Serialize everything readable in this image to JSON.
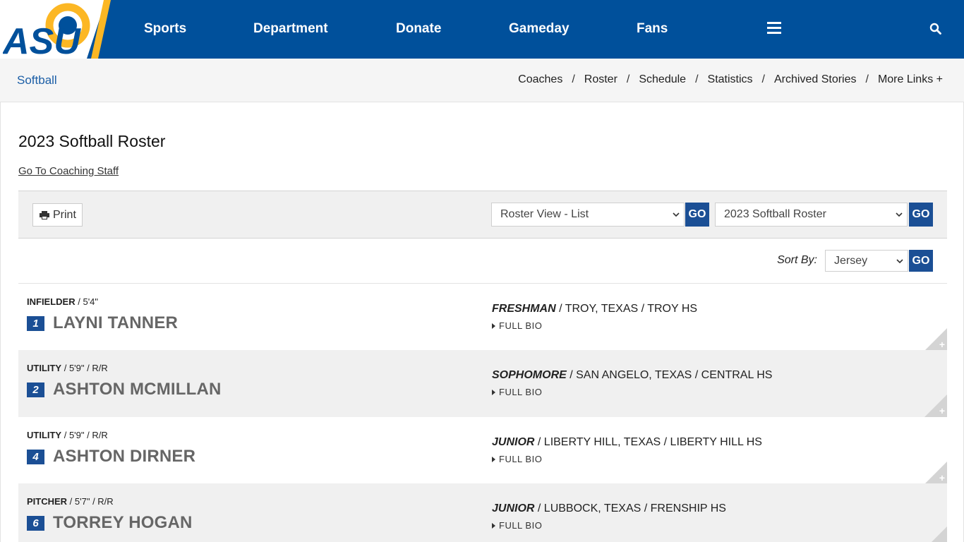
{
  "header": {
    "logo_text": "ASU",
    "nav": [
      {
        "label": "Sports"
      },
      {
        "label": "Department"
      },
      {
        "label": "Donate"
      },
      {
        "label": "Gameday"
      },
      {
        "label": "Fans"
      }
    ]
  },
  "subnav": {
    "title": "Softball",
    "links": [
      "Coaches",
      "Roster",
      "Schedule",
      "Statistics",
      "Archived Stories",
      "More Links +"
    ]
  },
  "page": {
    "title": "2023 Softball Roster",
    "coach_link": "Go To Coaching Staff"
  },
  "toolbar": {
    "print_label": "Print",
    "view_select": "Roster View - List",
    "season_select": "2023 Softball Roster",
    "go_label": "GO"
  },
  "sort": {
    "label": "Sort By:",
    "value": "Jersey",
    "go_label": "GO"
  },
  "players": [
    {
      "position": "INFIELDER",
      "details": " / 5'4\"",
      "number": "1",
      "name": "LAYNI TANNER",
      "year": "FRESHMAN",
      "hometown": " / TROY, TEXAS / TROY HS",
      "bio": "FULL BIO"
    },
    {
      "position": "UTILITY",
      "details": " / 5'9\" / R/R",
      "number": "2",
      "name": "ASHTON MCMILLAN",
      "year": "SOPHOMORE",
      "hometown": " / SAN ANGELO, TEXAS / CENTRAL HS",
      "bio": "FULL BIO"
    },
    {
      "position": "UTILITY",
      "details": " / 5'9\" / R/R",
      "number": "4",
      "name": "ASHTON DIRNER",
      "year": "JUNIOR",
      "hometown": " / LIBERTY HILL, TEXAS / LIBERTY HILL HS",
      "bio": "FULL BIO"
    },
    {
      "position": "PITCHER",
      "details": " / 5'7\" / R/R",
      "number": "6",
      "name": "TORREY HOGAN",
      "year": "JUNIOR",
      "hometown": " / LUBBOCK, TEXAS / FRENSHIP HS",
      "bio": "FULL BIO"
    }
  ],
  "colors": {
    "brand_blue": "#00509b",
    "brand_gold": "#fcb724",
    "button_blue": "#1b4f95"
  }
}
